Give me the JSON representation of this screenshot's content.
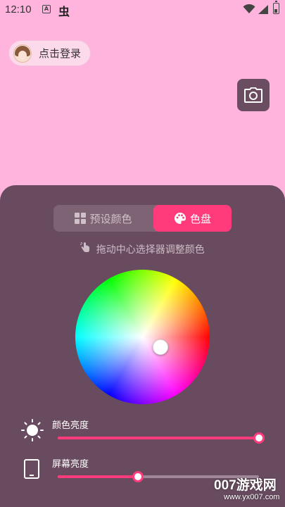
{
  "status_bar": {
    "time": "12:10",
    "icon_a": "A",
    "icon_bug": "虫",
    "icons": [
      "wifi-icon",
      "signal-icon",
      "battery-icon"
    ]
  },
  "login": {
    "label": "点击登录"
  },
  "camera": {
    "icon": "camera-icon"
  },
  "tabs": [
    {
      "label": "预设颜色",
      "selected": false
    },
    {
      "label": "色盘",
      "selected": true
    }
  ],
  "hint": "拖动中心选择器调整颜色",
  "sliders": [
    {
      "label": "颜色亮度",
      "value": 1.0,
      "icon": "sun-icon"
    },
    {
      "label": "屏幕亮度",
      "value": 0.4,
      "icon": "phone-icon"
    }
  ],
  "watermark": {
    "text": "007游戏网",
    "url": "www.yx007.com"
  },
  "colors": {
    "accent": "#ff3b7c",
    "panel": "#694b5f",
    "background": "#ffb4dd"
  }
}
